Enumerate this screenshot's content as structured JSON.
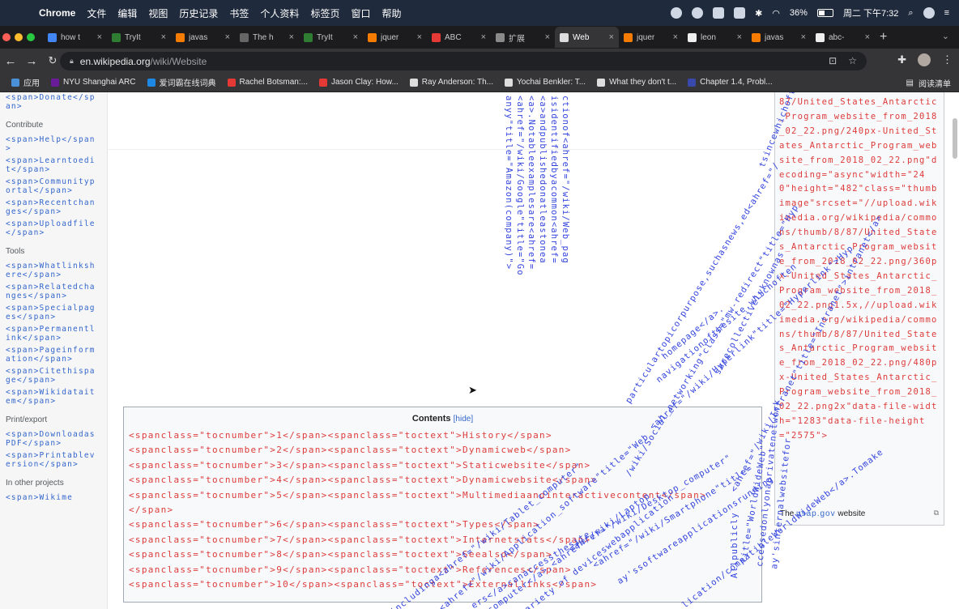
{
  "menubar": {
    "app": "Chrome",
    "items": [
      "文件",
      "编辑",
      "视图",
      "历史记录",
      "书签",
      "个人资料",
      "标签页",
      "窗口",
      "帮助"
    ],
    "battery": "36%",
    "clock": "周二 下午7:32"
  },
  "tabs": [
    {
      "label": "how t",
      "color": "#4285f4"
    },
    {
      "label": "TryIt",
      "color": "#2e7d32"
    },
    {
      "label": "javas",
      "color": "#f57c00"
    },
    {
      "label": "The h",
      "color": "#666666"
    },
    {
      "label": "TryIt",
      "color": "#2e7d32"
    },
    {
      "label": "jquer",
      "color": "#f57c00"
    },
    {
      "label": "ABC",
      "color": "#e53935"
    },
    {
      "label": "扩展",
      "color": "#8a8a8a"
    },
    {
      "label": "Web",
      "color": "#dddddd",
      "active": true
    },
    {
      "label": "jquer",
      "color": "#f57c00"
    },
    {
      "label": "leon",
      "color": "#eeeeee"
    },
    {
      "label": "javas",
      "color": "#f57c00"
    },
    {
      "label": "abc-",
      "color": "#eeeeee"
    }
  ],
  "tab_menu": "⌄",
  "address": {
    "host": "en.wikipedia.org",
    "path": "/wiki/Website"
  },
  "bookmarks": [
    {
      "label": "应用",
      "color": "#4a90d9"
    },
    {
      "label": "NYU Shanghai ARC",
      "color": "#6a1b9a"
    },
    {
      "label": "爱词霸在线词典",
      "color": "#1e88e5"
    },
    {
      "label": "Rachel Botsman:...",
      "color": "#e53935"
    },
    {
      "label": "Jason Clay: How...",
      "color": "#e53935"
    },
    {
      "label": "Ray Anderson: Th...",
      "color": "#dddddd"
    },
    {
      "label": "Yochai Benkler: T...",
      "color": "#dddddd"
    },
    {
      "label": "What they don't t...",
      "color": "#dddddd"
    },
    {
      "label": "Chapter 1.4, Probl...",
      "color": "#3949ab"
    }
  ],
  "reading_list": "阅读清单",
  "sidebar": {
    "donate": "<span>Donate</span>",
    "contribute_heading": "Contribute",
    "contribute": [
      "<span>Help</span>",
      "<span>Learntoedit</span>",
      "<span>Communityportal</span>",
      "<span>Recentchanges</span>",
      "<span>Uploadfile</span>"
    ],
    "tools_heading": "Tools",
    "tools": [
      "<span>Whatlinkshere</span>",
      "<span>Relatedchanges</span>",
      "<span>Specialpages</span>",
      "<span>Permanentlink</span>",
      "<span>Pageinformation</span>",
      "<span>Citethispage</span>",
      "<span>Wikidataitem</span>"
    ],
    "print_heading": "Print/export",
    "print": [
      "<span>DownloadasPDF</span>",
      "<span>Printableversion</span>"
    ],
    "other_heading": "In other projects",
    "other": [
      "<span>Wikime"
    ]
  },
  "toc": {
    "title": "Contents",
    "hide": "hide",
    "lines": [
      "<spanclass=\"tocnumber\">1</span><spanclass=\"toctext\">History</span>",
      "<spanclass=\"tocnumber\">2</span><spanclass=\"toctext\">Dynamicweb</span>",
      "<spanclass=\"tocnumber\">3</span><spanclass=\"toctext\">Staticwebsite</span>",
      "<spanclass=\"tocnumber\">4</span><spanclass=\"toctext\">Dynamicwebsite</span>",
      "<spanclass=\"tocnumber\">5</span><spanclass=\"toctext\">Multimediaandinteractivecontent</span>",
      "</span>",
      "<spanclass=\"tocnumber\">6</span><spanclass=\"toctext\">Types</span>",
      "<spanclass=\"tocnumber\">7</span><spanclass=\"toctext\">Internetstats</span>",
      "<spanclass=\"tocnumber\">8</span><spanclass=\"toctext\">Seealso</span>",
      "<spanclass=\"tocnumber\">9</span><spanclass=\"toctext\">References</span>",
      "<spanclass=\"tocnumber\">10</span><spanclass=\"toctext\">Externallinks</span>"
    ]
  },
  "infobox": {
    "code_lines": [
      "87/United_States_Antarctic_Program_website_from_2018_02_22.png/240px-United_States_Antarctic_Program_website_from_2018_02_22.png\"decoding=\"async\"width=\"240\"height=\"482\"class=\"thumbimage\"srcset=\"//upload.wikimedia.org/wikipedia/commons/thumb/8/87/United_States_Antarctic_Program_website_from_2018_02_22.png/360px-United_States_Antarctic_Program_website_from_2018_02_22.png1.5x,//upload.wikimedia.org/wikipedia/commons/thumb/8/87/United_States_Antarctic_Program_website_from_2018_02_22.png/480px-United_States_Antarctic_Program_website_from_2018_02_22.png2x\"data-file-width=\"1283\"data-file-height=\"2575\">"
    ],
    "caption_pre": "The",
    "caption_link": "usap.gov",
    "caption_post": "website"
  },
  "vertical_columns": [
    "anyy\"title=\"Amazon(company)\">",
    "<ahref=\"/wiki/Google\"title=\"Go",
    "<a>.Notableexamplesare<ahref=",
    "<a>andpublishedonatleastonea",
    "isidentifiedbyacommon<ahref=",
    "ctionof<ahref=\"/wiki/Web_pag"
  ],
  "diagonal_texts": [
    "particulartopicorpurpose,suchasnews,ed<ahref=\"/",
    "/wiki/Social_networking\"class=\"mw-redirect\"title=\"Hyp",
    "<ahref=\"/wiki/Hyperlink\"title=\"Hyperlink\">Hyp",
    "navigationofthesite,whichoften",
    "homepage</a>.",
    "sarecollectivelyknownas",
    "tsincewhichoftenstartswitha",
    "lication/compatibleWorldWideWeb</a>.Tomake",
    "<ahref=\"/wiki/Intranet\"title=\"Intranet\">intranet</a>",
    "Allpublicly",
    "title=\"WorldWideWeb\"",
    "ccessedonlyonaprivatenetwork",
    "ay'sinternalwebsitefor",
    "ers</a>canaccessthesite",
    "<ahref=\"/wiki/Desktop_computer\"",
    "<ahref=\"/wiki/Smartphone\"title=",
    "computer</a>,<ahref=\"/wiki/Laptop",
    "includinga<ahref=\"/wiki/Tablet_computer\"",
    "<ahref=\"/wiki/Application_software\"title=\"Web",
    "ay'ssoftwareapplicationsrunning",
    "variety of deviceswebapplication"
  ]
}
